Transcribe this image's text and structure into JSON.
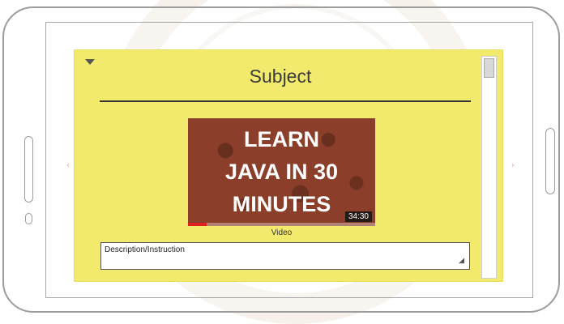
{
  "card": {
    "title": "Subject",
    "toggle_icon": "triangle-down-icon",
    "accent_color": "#f2ea6c"
  },
  "video": {
    "title_lines": [
      "LEARN",
      "JAVA IN 30",
      "MINUTES"
    ],
    "duration": "34:30",
    "caption": "Video",
    "progress": 0.1,
    "background_color": "#8b3f2a"
  },
  "description": {
    "placeholder": "Description/Instruction"
  },
  "nav": {
    "left_arrow": "‹",
    "right_arrow": "›"
  }
}
